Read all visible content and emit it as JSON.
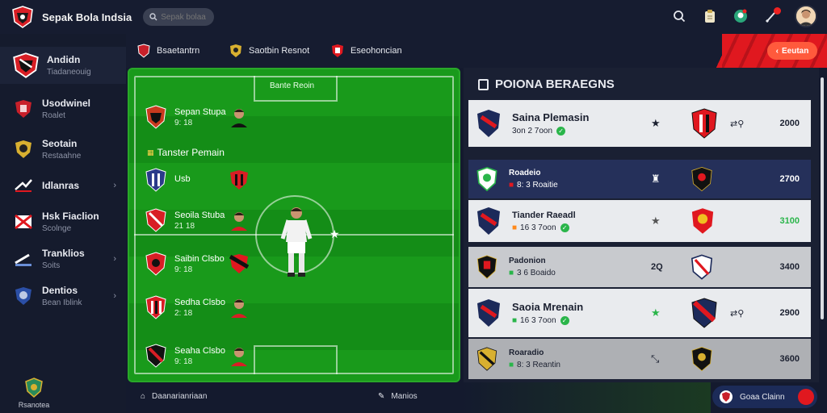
{
  "app": {
    "title": "Sepak Bola Indsia"
  },
  "search": {
    "placeholder": "Sepak bolaa"
  },
  "sidebar": {
    "items": [
      {
        "label": "Andidn",
        "sub": "Tiadaneouig"
      },
      {
        "label": "Usodwinel",
        "sub": "Roalet"
      },
      {
        "label": "Seotain",
        "sub": "Restaahne"
      },
      {
        "label": "Idlanras",
        "sub": ""
      },
      {
        "label": "Hsk Fiaclion",
        "sub": "Scolnge"
      },
      {
        "label": "Tranklios",
        "sub": "Soits"
      },
      {
        "label": "Dentios",
        "sub": "Bean Iblink"
      }
    ],
    "footer_label": "Rsanotea"
  },
  "header": {
    "tabs": [
      "Bsaetantrn",
      "Saotbin Resnot",
      "Eseohoncian"
    ],
    "cta_label": "Eeutan"
  },
  "pitch": {
    "title": "Bante Reoin",
    "transfer_label": "Tanster Pemain",
    "rows": [
      {
        "name": "Sepan Stupa",
        "sub": "9: 18"
      },
      {
        "name": "Usb",
        "sub": ""
      },
      {
        "name": "Seoila Stuba",
        "sub": "21 18"
      },
      {
        "name": "Saibin Clsbo",
        "sub": "9: 18"
      },
      {
        "name": "Sedha Clsbo",
        "sub": "2: 18"
      },
      {
        "name": "Seaha Clsbo",
        "sub": "9: 18"
      }
    ],
    "footer_left": "Daanarianriaan",
    "footer_right": "Manios"
  },
  "panel": {
    "title": "POIONA BERAEGNS",
    "cards": [
      {
        "name": "Saina Plemasin",
        "meta": "3on 2 7oon",
        "value": "2000"
      },
      {
        "name": "Roadeio",
        "meta": "8: 3 Roaitie",
        "value": "2700"
      },
      {
        "name": "Tiander Raeadl",
        "meta": "16 3 7oon",
        "value": "3100"
      },
      {
        "name": "Padonion",
        "meta": "3 6 Boaido",
        "value": "3400"
      },
      {
        "name": "Saoia Mrenain",
        "meta": "16 3 7oon",
        "value": "2900"
      },
      {
        "name": "Roaradio",
        "meta": "8: 3 Reantin",
        "value": "3600"
      }
    ]
  },
  "ticket": {
    "label": "Goaa Clainn"
  },
  "colors": {
    "accent_red": "#e0181f",
    "pitch_green": "#199a1b",
    "badge_green": "#2ab54a",
    "navy": "#25305a"
  }
}
